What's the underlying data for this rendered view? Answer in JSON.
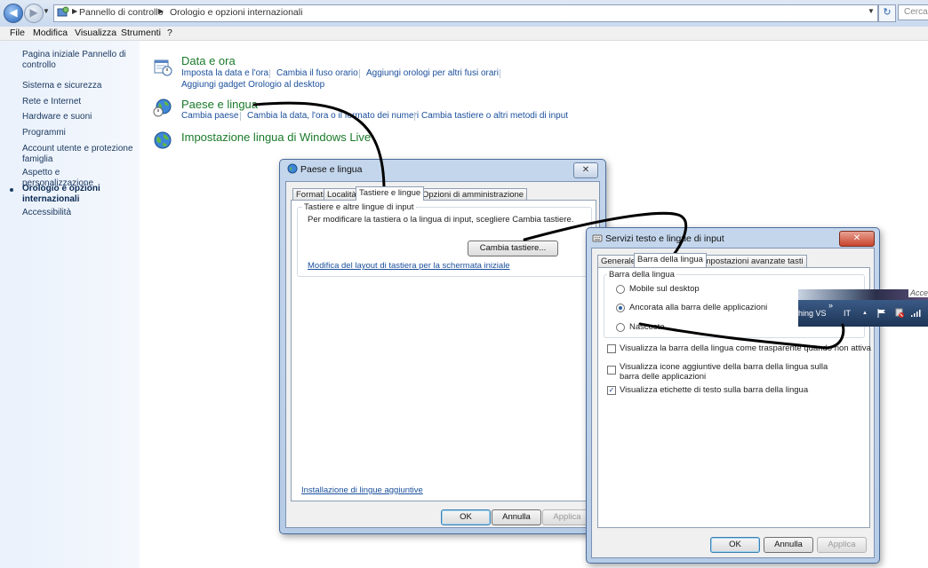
{
  "address": {
    "crumbs": [
      "Pannello di controllo",
      "Orologio e opzioni internazionali"
    ],
    "search_placeholder": "Cerca",
    "back_glyph": "◀",
    "forward_glyph": "▶",
    "refresh_glyph": "↻"
  },
  "menu": [
    "File",
    "Modifica",
    "Visualizza",
    "Strumenti",
    "?"
  ],
  "sidebar": {
    "items": [
      "Pagina iniziale Pannello di controllo",
      "Sistema e sicurezza",
      "Rete e Internet",
      "Hardware e suoni",
      "Programmi",
      "Account utente e protezione famiglia",
      "Aspetto e personalizzazione",
      "Orologio e opzioni internazionali",
      "Accessibilità"
    ]
  },
  "categories": {
    "date": {
      "title": "Data e ora",
      "links": [
        "Imposta la data e l'ora",
        "Cambia il fuso orario",
        "Aggiungi orologi per altri fusi orari",
        "Aggiungi gadget Orologio al desktop"
      ]
    },
    "region": {
      "title": "Paese e lingua",
      "links": [
        "Cambia paese",
        "Cambia la data, l'ora o il formato dei numeri",
        "Cambia tastiere o altri metodi di input"
      ]
    },
    "live": {
      "title": "Impostazione lingua di Windows Live"
    }
  },
  "win1": {
    "title": "Paese e lingua",
    "close": "✕",
    "tabs": [
      "Formati",
      "Località",
      "Tastiere e lingue",
      "Opzioni di amministrazione"
    ],
    "group_title": "Tastiere e altre lingue di input",
    "description": "Per modificare la tastiera o la lingua di input, scegliere Cambia tastiere.",
    "change_button": "Cambia tastiere...",
    "layout_link": "Modifica del layout di tastiera per la schermata iniziale",
    "install_link": "Installazione di lingue aggiuntive",
    "ok": "OK",
    "cancel": "Annulla",
    "apply": "Applica"
  },
  "win2": {
    "title": "Servizi testo e lingue di input",
    "close": "✕",
    "tabs": [
      "Generale",
      "Barra della lingua",
      "Impostazioni avanzate tasti"
    ],
    "group_title": "Barra della lingua",
    "radios": [
      "Mobile sul desktop",
      "Ancorata alla barra delle applicazioni",
      "Nascosta"
    ],
    "checks": [
      {
        "label": "Visualizza la barra della lingua come trasparente quando non attiva",
        "checked": false
      },
      {
        "label": "Visualizza icone aggiuntive della barra della lingua sulla barra delle applicazioni",
        "checked": false
      },
      {
        "label": "Visualizza etichette di testo sulla barra della lingua",
        "checked": true
      }
    ],
    "check_mark": "✓",
    "ok": "OK",
    "cancel": "Annulla",
    "apply": "Applica"
  },
  "tray": {
    "top_text": "Acce",
    "app_text": "hing VS",
    "chevron": "»",
    "lang": "IT",
    "arrow": "▲"
  }
}
